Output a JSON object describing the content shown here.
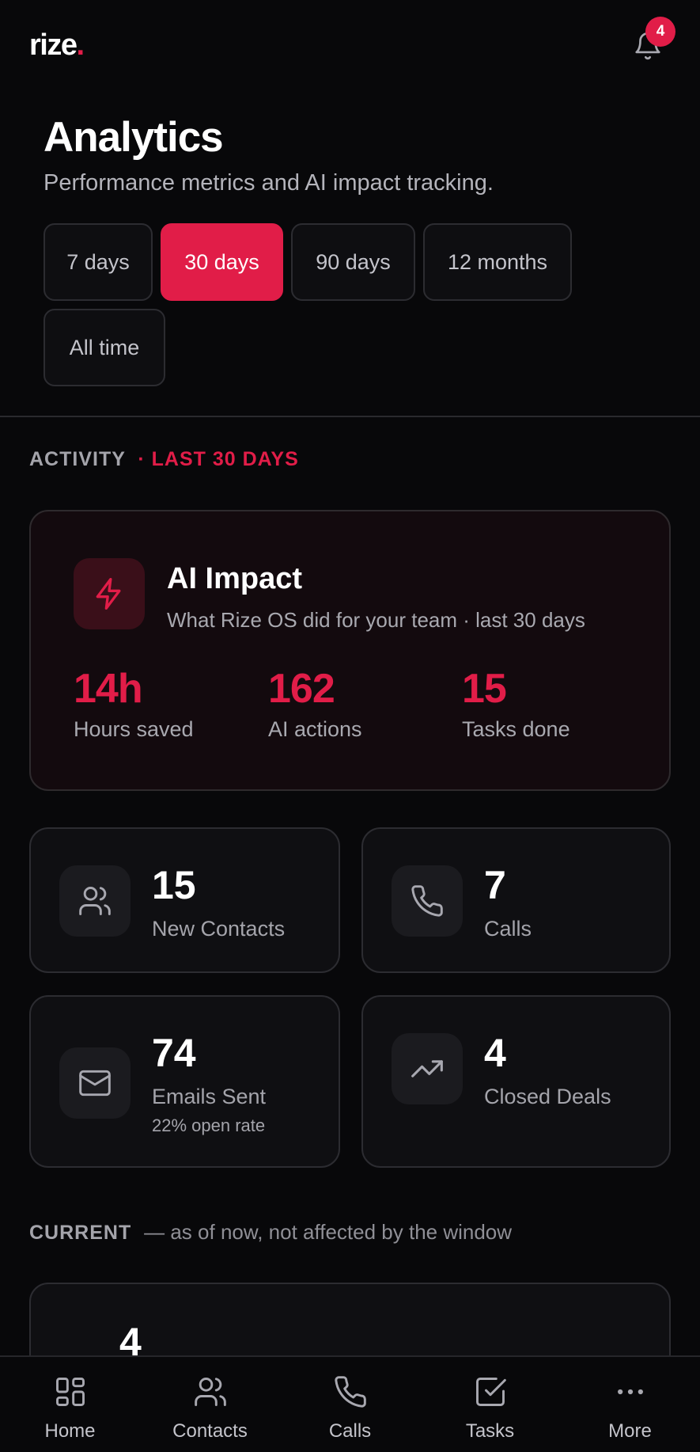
{
  "app": {
    "logo_text": "rize",
    "logo_dot": ".",
    "notifications_count": "4",
    "accent_color": "#e11d48"
  },
  "header": {
    "title": "Analytics",
    "subtitle": "Performance metrics and AI impact tracking."
  },
  "filters": {
    "items": [
      "7 days",
      "30 days",
      "90 days",
      "12 months",
      "All time"
    ],
    "selected": "30 days"
  },
  "activity": {
    "label": "ACTIVITY",
    "range": "· LAST 30 DAYS"
  },
  "ai_impact": {
    "icon": "lightning-icon",
    "title": "AI Impact",
    "subtitle": "What Rize OS did for your team · last 30 days",
    "stats": [
      {
        "value": "14h",
        "label": "Hours saved"
      },
      {
        "value": "162",
        "label": "AI actions"
      },
      {
        "value": "15",
        "label": "Tasks done"
      }
    ]
  },
  "metrics": [
    {
      "icon": "users-icon",
      "value": "15",
      "label": "New Contacts",
      "note": ""
    },
    {
      "icon": "phone-icon",
      "value": "7",
      "label": "Calls",
      "note": ""
    },
    {
      "icon": "mail-icon",
      "value": "74",
      "label": "Emails Sent",
      "note": "22% open rate"
    },
    {
      "icon": "trending-up-icon",
      "value": "4",
      "label": "Closed Deals",
      "note": ""
    }
  ],
  "current": {
    "label": "CURRENT",
    "note": "— as of now, not affected by the window",
    "peek_value": "4"
  },
  "bottom_nav": {
    "items": [
      {
        "icon": "home-grid-icon",
        "label": "Home"
      },
      {
        "icon": "contacts-icon",
        "label": "Contacts"
      },
      {
        "icon": "phone-icon",
        "label": "Calls"
      },
      {
        "icon": "tasks-icon",
        "label": "Tasks"
      },
      {
        "icon": "more-icon",
        "label": "More"
      }
    ]
  }
}
